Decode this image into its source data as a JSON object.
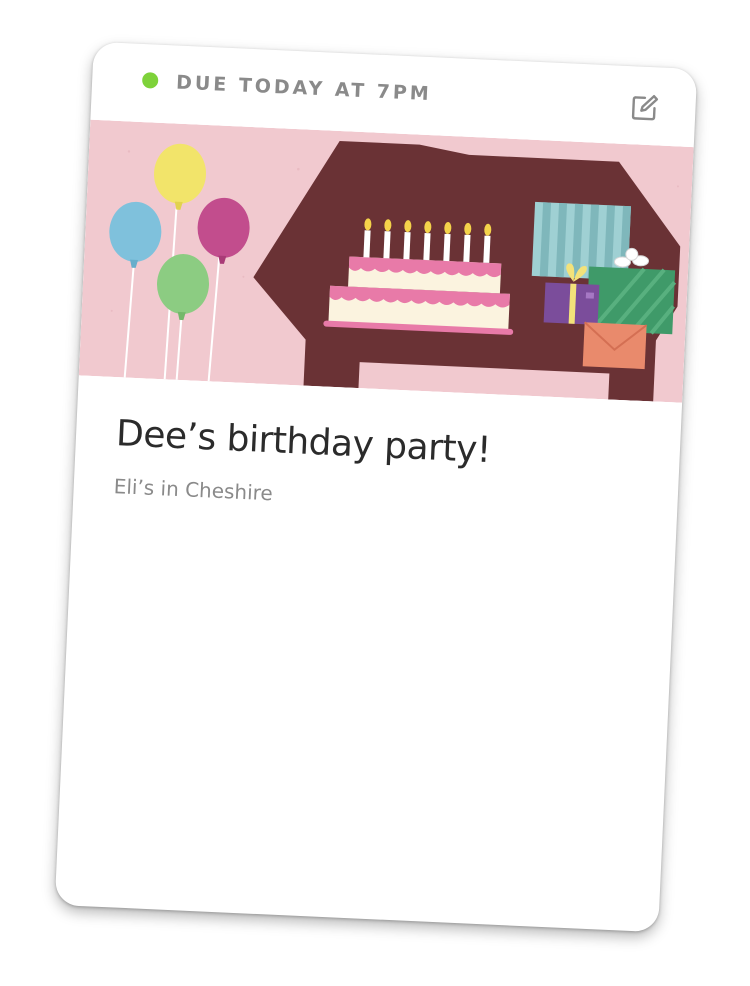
{
  "task_card": {
    "status": {
      "label": "DUE TODAY AT 7PM",
      "dot_color": "#7ed23a"
    },
    "edit_icon": "edit-icon",
    "banner": {
      "illustration": "birthday-party-illustration",
      "background_color": "#f0c8cf",
      "table_color": "#6a3235"
    },
    "title": "Dee’s birthday party!",
    "subtitle": "Eli’s in Cheshire"
  }
}
